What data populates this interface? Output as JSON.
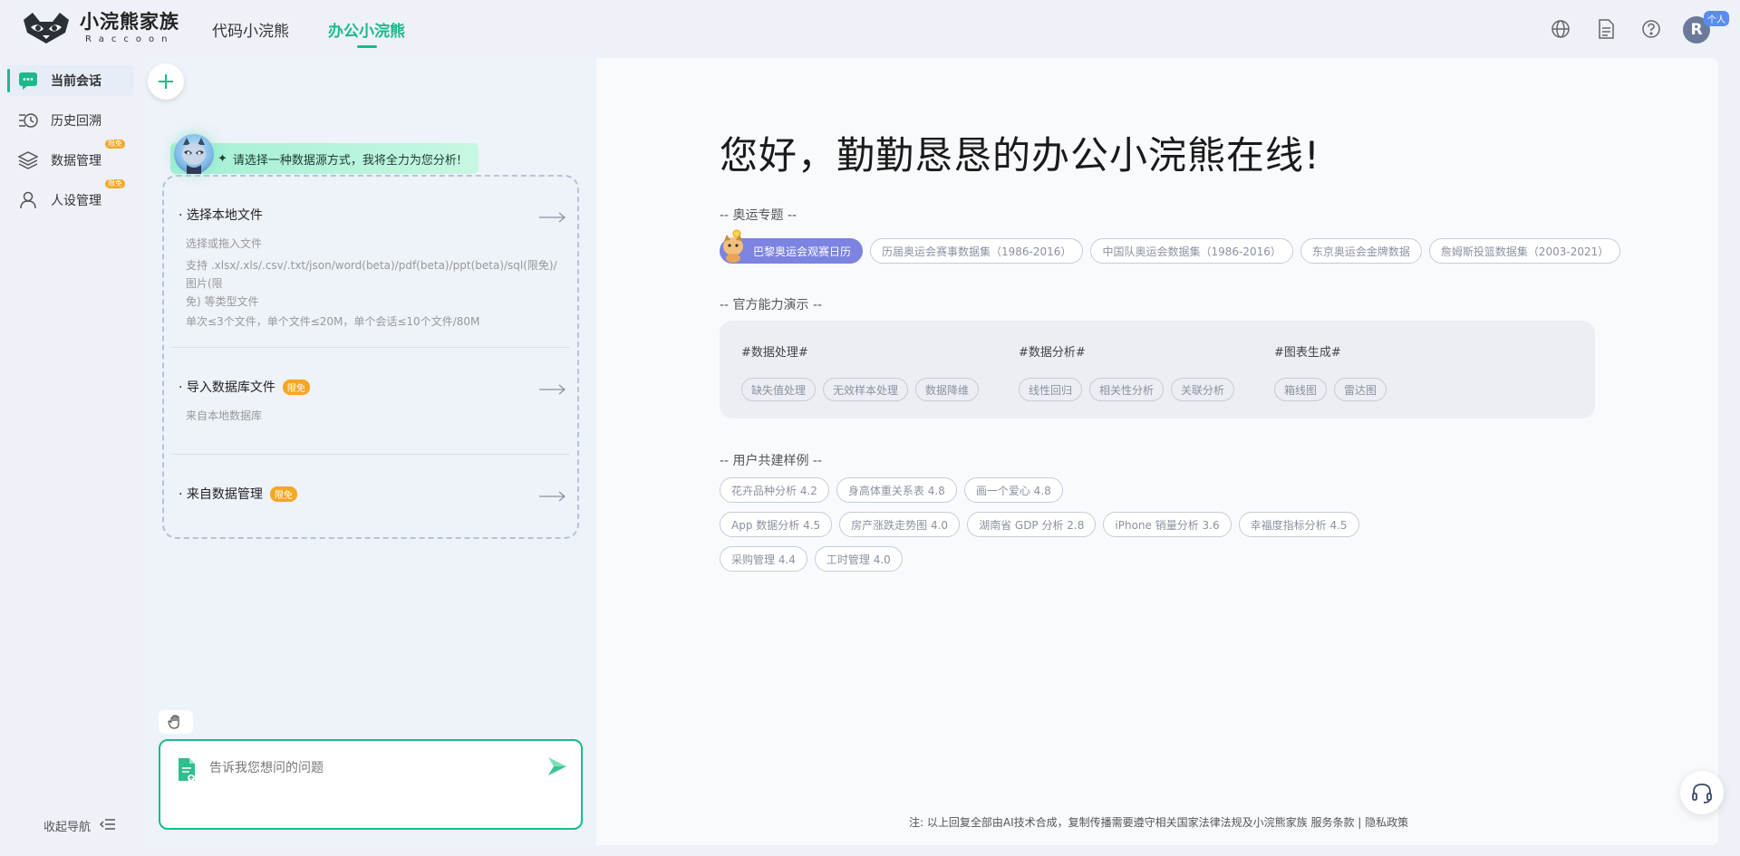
{
  "brand": {
    "title": "小浣熊家族",
    "subtitle": "Raccoon"
  },
  "top_tabs": [
    {
      "label": "代码小浣熊",
      "active": false
    },
    {
      "label": "办公小浣熊",
      "active": true
    }
  ],
  "header_icons": [
    "globe-icon",
    "document-icon",
    "help-icon"
  ],
  "user": {
    "initial": "R",
    "badge": "个人"
  },
  "sidebar": {
    "items": [
      {
        "label": "当前会话",
        "icon": "chat-icon",
        "active": true,
        "badge": ""
      },
      {
        "label": "历史回溯",
        "icon": "history-icon",
        "active": false,
        "badge": ""
      },
      {
        "label": "数据管理",
        "icon": "layers-icon",
        "active": false,
        "badge": "限免"
      },
      {
        "label": "人设管理",
        "icon": "person-icon",
        "active": false,
        "badge": "限免"
      }
    ],
    "collapse_label": "收起导航"
  },
  "left_panel": {
    "greeting": "请选择一种数据源方式，我将全力为您分析!",
    "sources": [
      {
        "title": "· 选择本地文件",
        "badge": "",
        "desc": [
          "选择或拖入文件",
          "支持 .xlsx/.xls/.csv/.txt/json/word(beta)/pdf(beta)/ppt(beta)/sql(限免)/图片(限",
          "免) 等类型文件",
          "单次≤3个文件，单个文件≤20M，单个会话≤10个文件/80M"
        ]
      },
      {
        "title": "· 导入数据库文件",
        "badge": "限免",
        "desc": [
          "来自本地数据库"
        ]
      },
      {
        "title": "· 来自数据管理",
        "badge": "限免",
        "desc": []
      }
    ],
    "input_placeholder": "告诉我您想问的问题"
  },
  "main": {
    "welcome": "您好，勤勤恳恳的办公小浣熊在线!",
    "olympics": {
      "title": "-- 奥运专题 --",
      "chips": [
        "巴黎奥运会观赛日历",
        "历届奥运会赛事数据集（1986-2016）",
        "中国队奥运会数据集（1986-2016）",
        "东京奥运会金牌数据",
        "詹姆斯投篮数据集（2003-2021）"
      ]
    },
    "capabilities": {
      "title": "-- 官方能力演示 --",
      "groups": [
        {
          "head": "#数据处理#",
          "chips": [
            "缺失值处理",
            "无效样本处理",
            "数据降维"
          ]
        },
        {
          "head": "#数据分析#",
          "chips": [
            "线性回归",
            "相关性分析",
            "关联分析"
          ]
        },
        {
          "head": "#图表生成#",
          "chips": [
            "箱线图",
            "雷达图"
          ]
        }
      ]
    },
    "examples": {
      "title": "-- 用户共建样例 --",
      "rows": [
        [
          "花卉品种分析 4.2",
          "身高体重关系表 4.8",
          "画一个爱心 4.8"
        ],
        [
          "App 数据分析 4.5",
          "房产涨跌走势图 4.0",
          "湖南省 GDP 分析 2.8",
          "iPhone 销量分析 3.6",
          "幸福度指标分析 4.5"
        ],
        [
          "采购管理 4.4",
          "工时管理 4.0"
        ]
      ]
    },
    "footer": {
      "note": "注: 以上回复全部由AI技术合成，复制传播需要遵守相关国家法律法规及小浣熊家族 ",
      "terms": "服务条款",
      "sep": " | ",
      "privacy": "隐私政策"
    }
  },
  "colors": {
    "accent": "#1db98a",
    "featured_chip": "#7c83e0",
    "badge": "#f5a623"
  }
}
